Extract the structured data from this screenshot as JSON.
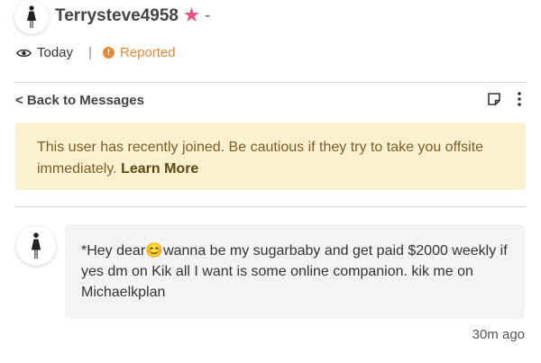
{
  "header": {
    "username": "Terrysteve4958",
    "dash": "-"
  },
  "meta": {
    "visibility": "Today",
    "separator": "|",
    "status": "Reported",
    "status_icon": "!"
  },
  "toolbar": {
    "back_label": "< Back to Messages"
  },
  "banner": {
    "text": "This user has recently joined. Be cautious if they try to take you offsite immediately.",
    "link": "Learn More"
  },
  "message": {
    "text": "*Hey dear😊wanna be my sugarbaby and get paid $2000 weekly if yes dm on Kik all I want is some online companion. kik me on Michaelkplan",
    "timestamp": "30m ago"
  },
  "colors": {
    "accent_pink": "#e8507f",
    "status_orange": "#e28a3c",
    "banner_bg": "#fbf1cf",
    "bubble_bg": "#f4f4f4"
  },
  "icons": {
    "avatar": "female-figure-icon",
    "star": "star-icon",
    "visibility": "eye-icon",
    "status": "warning-icon",
    "note": "note-icon",
    "more": "more-vertical-icon"
  }
}
